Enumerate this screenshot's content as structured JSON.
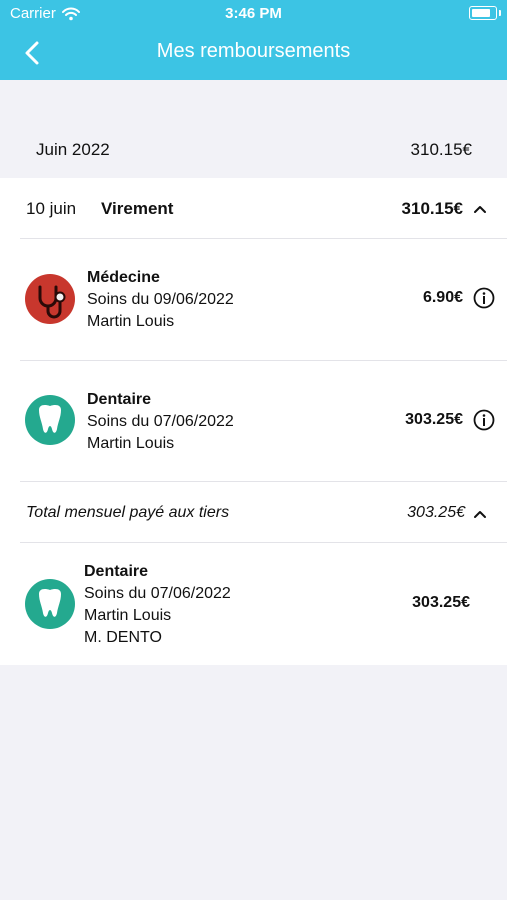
{
  "status_bar": {
    "carrier": "Carrier",
    "time": "3:46 PM"
  },
  "nav": {
    "title": "Mes remboursements"
  },
  "colors": {
    "header": "#3cc4e4",
    "medecine": "#c8372d",
    "dentaire": "#24a98f"
  },
  "month": {
    "label": "Juin 2022",
    "amount": "310.15€"
  },
  "transfer": {
    "date": "10 juin",
    "type": "Virement",
    "amount": "310.15€"
  },
  "items": [
    {
      "category": "Médecine",
      "care": "Soins du 09/06/2022",
      "beneficiary": "Martin Louis",
      "amount": "6.90€",
      "icon": "stethoscope-icon"
    },
    {
      "category": "Dentaire",
      "care": "Soins du 07/06/2022",
      "beneficiary": "Martin Louis",
      "amount": "303.25€",
      "icon": "tooth-icon"
    }
  ],
  "third_party": {
    "label": "Total mensuel payé aux tiers",
    "amount": "303.25€",
    "item": {
      "category": "Dentaire",
      "care": "Soins du 07/06/2022",
      "beneficiary": "Martin Louis",
      "provider": "M. DENTO",
      "amount": "303.25€",
      "icon": "tooth-icon"
    }
  }
}
